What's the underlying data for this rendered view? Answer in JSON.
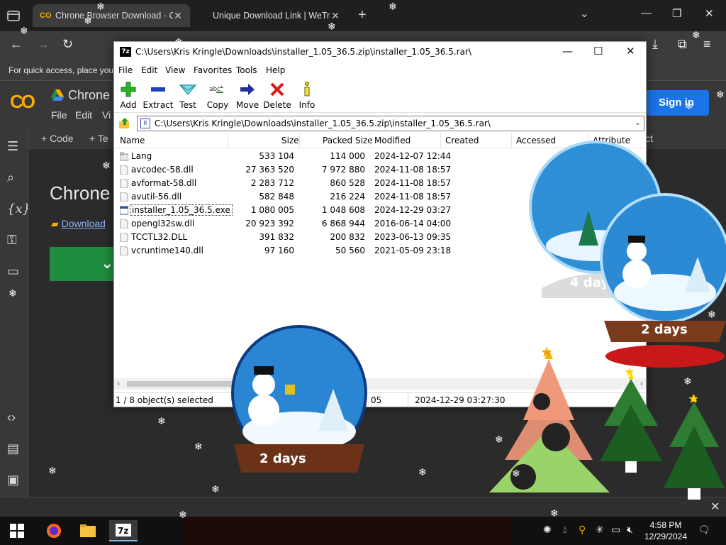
{
  "browser": {
    "tabs": [
      {
        "title": "Chrone Browser Download - Co",
        "active": true
      },
      {
        "title": "Unique Download Link | WeTra",
        "active": false
      }
    ],
    "bookmarks_bar_text": "For quick access, place your"
  },
  "colab": {
    "title": "Chrone",
    "menu": [
      "File",
      "Edit",
      "Vi"
    ],
    "signin_label": "Sign in",
    "cellbar": [
      "+ Code",
      "+ Te",
      "ct"
    ],
    "heading": "Chrone",
    "link": "Download",
    "rail_icons": [
      "table-of-contents-icon",
      "search-icon",
      "variables-icon",
      "key-icon",
      "folder-icon",
      "code-snippets-icon",
      "command-palette-icon",
      "terminal-icon"
    ]
  },
  "zip_window": {
    "title": "C:\\Users\\Kris Kringle\\Downloads\\installer_1.05_36.5.zip\\installer_1.05_36.5.rar\\",
    "menu": [
      "File",
      "Edit",
      "View",
      "Favorites",
      "Tools",
      "Help"
    ],
    "toolbar": [
      {
        "label": "Add",
        "icon": "add-icon"
      },
      {
        "label": "Extract",
        "icon": "extract-icon"
      },
      {
        "label": "Test",
        "icon": "test-icon"
      },
      {
        "label": "Copy",
        "icon": "copy-icon"
      },
      {
        "label": "Move",
        "icon": "move-icon"
      },
      {
        "label": "Delete",
        "icon": "delete-icon"
      },
      {
        "label": "Info",
        "icon": "info-icon"
      }
    ],
    "address": "C:\\Users\\Kris Kringle\\Downloads\\installer_1.05_36.5.zip\\installer_1.05_36.5.rar\\",
    "columns": [
      "Name",
      "Size",
      "Packed Size",
      "Modified",
      "Created",
      "Accessed",
      "Attribute"
    ],
    "files": [
      {
        "name": "Lang",
        "size": "533 104",
        "packed": "114 000",
        "modified": "2024-12-07 12:44",
        "type": "folder"
      },
      {
        "name": "avcodec-58.dll",
        "size": "27 363 520",
        "packed": "7 972 880",
        "modified": "2024-11-08 18:57",
        "type": "dll"
      },
      {
        "name": "avformat-58.dll",
        "size": "2 283 712",
        "packed": "860 528",
        "modified": "2024-11-08 18:57",
        "type": "dll"
      },
      {
        "name": "avutil-56.dll",
        "size": "582 848",
        "packed": "216 224",
        "modified": "2024-11-08 18:57",
        "type": "dll"
      },
      {
        "name": "installer_1.05_36.5.exe",
        "size": "1 080 005",
        "packed": "1 048 608",
        "modified": "2024-12-29 03:27",
        "type": "exe"
      },
      {
        "name": "opengl32sw.dll",
        "size": "20 923 392",
        "packed": "6 868 944",
        "modified": "2016-06-14 04:00",
        "type": "dll"
      },
      {
        "name": "TCCTL32.DLL",
        "size": "391 832",
        "packed": "200 832",
        "modified": "2023-06-13 09:35",
        "type": "dll"
      },
      {
        "name": "vcruntime140.dll",
        "size": "97 160",
        "packed": "50 560",
        "modified": "2021-05-09 23:18",
        "type": "dll"
      }
    ],
    "status": {
      "selection": "1 / 8 object(s) selected",
      "size_fragment": "05",
      "modified": "2024-12-29 03:27:30"
    }
  },
  "decorations": {
    "globe_labels": [
      "2 days",
      "2 days",
      "4 days"
    ]
  },
  "taskbar": {
    "time": "4:58 PM",
    "date": "12/29/2024",
    "apps": [
      "firefox-icon",
      "file-explorer-icon",
      "7zip-icon"
    ]
  },
  "colors": {
    "signin_blue": "#1a73e8",
    "colab_orange": "#f9ab00",
    "green_cell": "#1e8e3e",
    "selection_outline": "#333333"
  }
}
